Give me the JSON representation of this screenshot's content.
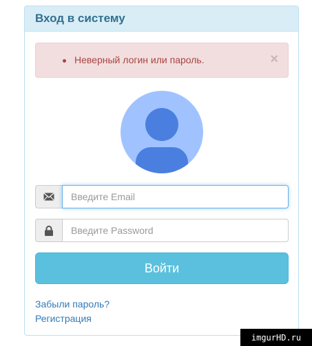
{
  "panel": {
    "title": "Вход в систему"
  },
  "alert": {
    "message": "Неверный логин или пароль.",
    "close_label": "×"
  },
  "avatar": {
    "icon": "user-avatar-icon"
  },
  "form": {
    "email_placeholder": "Введите Email",
    "email_value": "",
    "password_placeholder": "Введите Password",
    "password_value": "",
    "email_icon": "envelope-icon",
    "password_icon": "lock-icon",
    "submit_label": "Войти"
  },
  "links": {
    "forgot_password": "Забыли пароль?",
    "register": "Регистрация"
  },
  "watermark": {
    "text": "imgurHD.ru"
  },
  "colors": {
    "heading_bg": "#d9edf7",
    "heading_text": "#31708f",
    "alert_bg": "#f2dede",
    "alert_text": "#a94442",
    "button_bg": "#5bc0de",
    "link": "#337ab7"
  }
}
